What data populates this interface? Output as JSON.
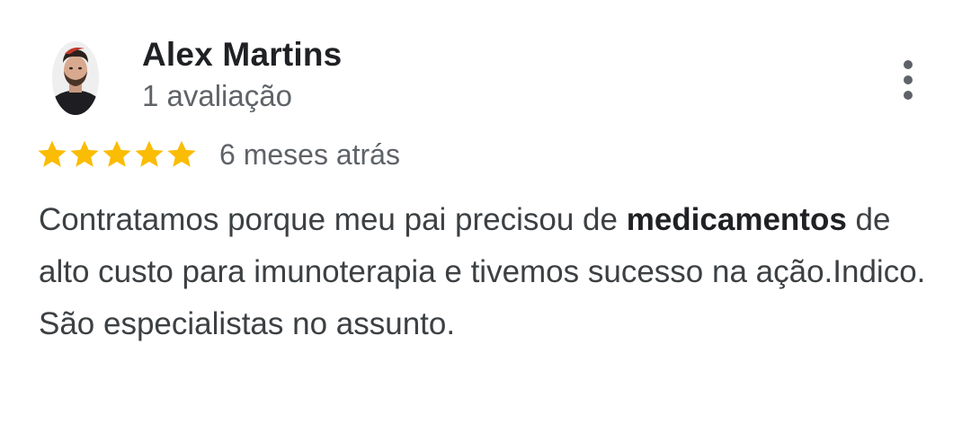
{
  "review": {
    "author": {
      "name": "Alex Martins",
      "review_count": "1 avaliação",
      "avatar_icon": "user-avatar-photo"
    },
    "menu_icon": "more-vert-icon",
    "rating": {
      "stars": 5,
      "max_stars": 5,
      "star_color": "#fbbc04",
      "star_icon": "star-icon"
    },
    "date": "6 meses atrás",
    "text": {
      "part1": "Contratamos porque meu pai precisou de ",
      "highlight": "medicamentos",
      "part2": " de alto custo para imunoterapia e tivemos sucesso na ação.Indico. São especialistas no assunto."
    }
  }
}
